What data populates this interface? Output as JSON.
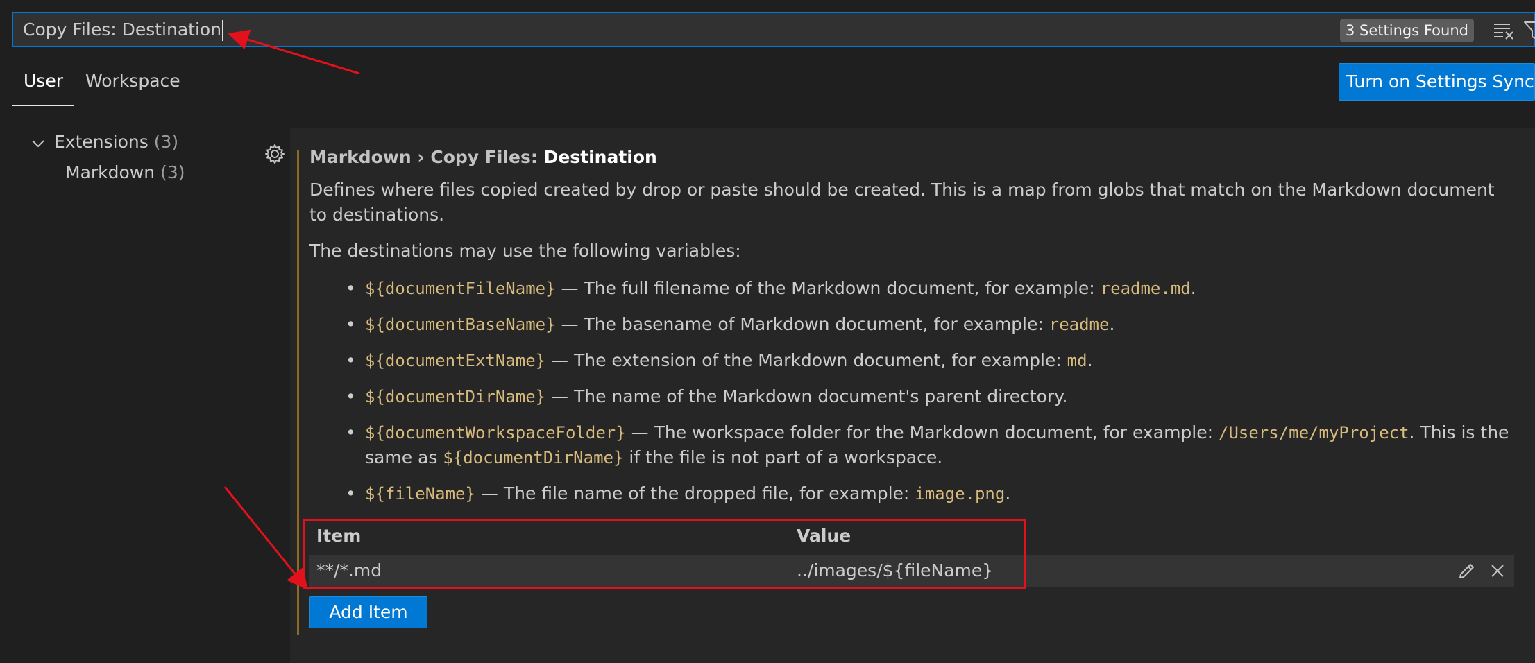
{
  "search": {
    "value": "Copy Files: Destination",
    "results_badge": "3 Settings Found"
  },
  "tabs": [
    {
      "label": "User",
      "active": true
    },
    {
      "label": "Workspace",
      "active": false
    }
  ],
  "sync_button": "Turn on Settings Sync",
  "tree": {
    "group_label": "Extensions",
    "group_count": "(3)",
    "item_label": "Markdown",
    "item_count": "(3)"
  },
  "setting": {
    "crumb1": "Markdown",
    "crumb_sep": " › ",
    "crumb2": "Copy Files: ",
    "name": "Destination",
    "description": "Defines where files copied created by drop or paste should be created. This is a map from globs that match on the Markdown document to destinations.",
    "variables_intro": "The destinations may use the following variables:",
    "variables": [
      {
        "code": "${documentFileName}",
        "text": " — The full filename of the Markdown document, for example: ",
        "example": "readme.md",
        "tail": "."
      },
      {
        "code": "${documentBaseName}",
        "text": " — The basename of Markdown document, for example: ",
        "example": "readme",
        "tail": "."
      },
      {
        "code": "${documentExtName}",
        "text": " — The extension of the Markdown document, for example: ",
        "example": "md",
        "tail": "."
      },
      {
        "code": "${documentDirName}",
        "text": " — The name of the Markdown document's parent directory.",
        "example": "",
        "tail": ""
      },
      {
        "code": "${documentWorkspaceFolder}",
        "text": " — The workspace folder for the Markdown document, for example: ",
        "example": "/Users/me/myProject",
        "tail": ". This is the same as ",
        "code2": "${documentDirName}",
        "tail2": " if the file is not part of a workspace."
      },
      {
        "code": "${fileName}",
        "text": " — The file name of the dropped file, for example: ",
        "example": "image.png",
        "tail": "."
      }
    ],
    "table": {
      "header_item": "Item",
      "header_value": "Value",
      "rows": [
        {
          "item": "**/*.md",
          "value": "../images/${fileName}"
        }
      ]
    },
    "add_button": "Add Item"
  },
  "colors": {
    "accent": "#0078d4",
    "annotation": "#e3111b",
    "code": "#d7ba7d",
    "modified_bar": "#8e6a23"
  }
}
